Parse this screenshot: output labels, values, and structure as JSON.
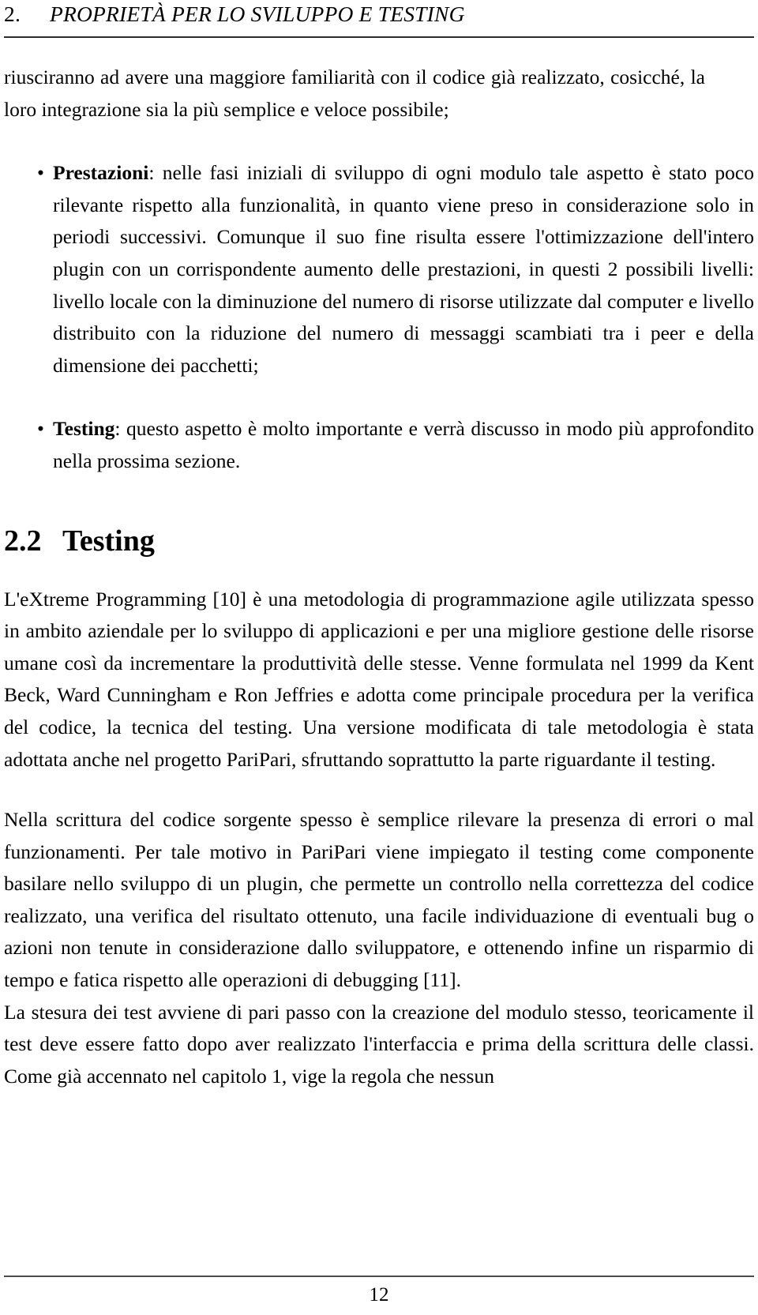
{
  "header": {
    "chapter_number": "2.",
    "chapter_title": "PROPRIETÀ PER LO SVILUPPO E TESTING"
  },
  "body": {
    "continuation_paragraph": "riusciranno ad avere una maggiore familiarità con il codice già realizzato, cosicché, la loro integrazione sia la più semplice e veloce possibile;",
    "list_items": [
      {
        "bullet": "•",
        "term": "Prestazioni",
        "separator": ": ",
        "text": "nelle fasi iniziali di sviluppo di ogni modulo tale aspetto è stato poco rilevante rispetto alla funzionalità, in quanto viene preso in considerazione solo in periodi successivi. Comunque il suo fine risulta essere l'ottimizzazione dell'intero plugin con un corrispondente aumento delle prestazioni, in questi 2 possibili livelli: livello locale con la diminuzione del numero di risorse utilizzate dal computer e livello distribuito con la riduzione del numero di messaggi scambiati tra i peer e della dimensione dei pacchetti;"
      },
      {
        "bullet": "•",
        "term": "Testing",
        "separator": ": ",
        "text": "questo aspetto è molto importante e verrà discusso in modo più approfondito nella prossima sezione."
      }
    ],
    "section": {
      "number": "2.2",
      "title": "Testing"
    },
    "paragraphs": [
      "L'eXtreme Programming [10] è una metodologia di programmazione agile utilizzata spesso in ambito aziendale per lo sviluppo di applicazioni e per una migliore gestione delle risorse umane così da incrementare la produttività delle stesse. Venne formulata nel 1999 da Kent Beck, Ward Cunningham e Ron Jeffries e adotta come principale procedura per la verifica del codice, la tecnica del testing. Una versione modificata di tale metodologia è stata adottata anche nel progetto PariPari, sfruttando soprattutto la parte riguardante il testing.",
      "Nella scrittura del codice sorgente spesso è semplice rilevare la presenza di errori o mal funzionamenti. Per tale motivo in PariPari viene impiegato il testing come componente basilare nello sviluppo di un plugin, che permette un controllo nella correttezza del codice realizzato, una verifica del risultato ottenuto, una facile individuazione di eventuali bug o azioni non tenute in considerazione dallo sviluppatore, e ottenendo infine un risparmio di tempo e fatica rispetto alle operazioni di debugging [11].",
      "La stesura dei test avviene di pari passo con la creazione del modulo stesso, teoricamente il test deve essere fatto dopo aver realizzato l'interfaccia e prima della scrittura delle classi. Come già accennato nel capitolo 1, vige la regola che nessun"
    ]
  },
  "footer": {
    "page_number": "12"
  }
}
